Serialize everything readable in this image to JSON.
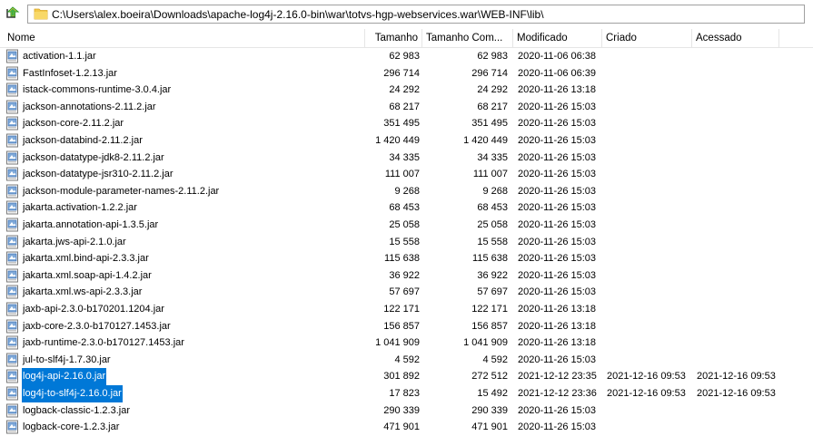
{
  "address": {
    "path": "C:\\Users\\alex.boeira\\Downloads\\apache-log4j-2.16.0-bin\\war\\totvs-hgp-webservices.war\\WEB-INF\\lib\\"
  },
  "columns": {
    "name": "Nome",
    "size": "Tamanho",
    "compressed": "Tamanho Com...",
    "modified": "Modificado",
    "created": "Criado",
    "accessed": "Acessado"
  },
  "files": [
    {
      "name": "activation-1.1.jar",
      "size": "62 983",
      "compressed": "62 983",
      "modified": "2020-11-06 06:38",
      "created": "",
      "accessed": "",
      "selected": false
    },
    {
      "name": "FastInfoset-1.2.13.jar",
      "size": "296 714",
      "compressed": "296 714",
      "modified": "2020-11-06 06:39",
      "created": "",
      "accessed": "",
      "selected": false
    },
    {
      "name": "istack-commons-runtime-3.0.4.jar",
      "size": "24 292",
      "compressed": "24 292",
      "modified": "2020-11-26 13:18",
      "created": "",
      "accessed": "",
      "selected": false
    },
    {
      "name": "jackson-annotations-2.11.2.jar",
      "size": "68 217",
      "compressed": "68 217",
      "modified": "2020-11-26 15:03",
      "created": "",
      "accessed": "",
      "selected": false
    },
    {
      "name": "jackson-core-2.11.2.jar",
      "size": "351 495",
      "compressed": "351 495",
      "modified": "2020-11-26 15:03",
      "created": "",
      "accessed": "",
      "selected": false
    },
    {
      "name": "jackson-databind-2.11.2.jar",
      "size": "1 420 449",
      "compressed": "1 420 449",
      "modified": "2020-11-26 15:03",
      "created": "",
      "accessed": "",
      "selected": false
    },
    {
      "name": "jackson-datatype-jdk8-2.11.2.jar",
      "size": "34 335",
      "compressed": "34 335",
      "modified": "2020-11-26 15:03",
      "created": "",
      "accessed": "",
      "selected": false
    },
    {
      "name": "jackson-datatype-jsr310-2.11.2.jar",
      "size": "111 007",
      "compressed": "111 007",
      "modified": "2020-11-26 15:03",
      "created": "",
      "accessed": "",
      "selected": false
    },
    {
      "name": "jackson-module-parameter-names-2.11.2.jar",
      "size": "9 268",
      "compressed": "9 268",
      "modified": "2020-11-26 15:03",
      "created": "",
      "accessed": "",
      "selected": false
    },
    {
      "name": "jakarta.activation-1.2.2.jar",
      "size": "68 453",
      "compressed": "68 453",
      "modified": "2020-11-26 15:03",
      "created": "",
      "accessed": "",
      "selected": false
    },
    {
      "name": "jakarta.annotation-api-1.3.5.jar",
      "size": "25 058",
      "compressed": "25 058",
      "modified": "2020-11-26 15:03",
      "created": "",
      "accessed": "",
      "selected": false
    },
    {
      "name": "jakarta.jws-api-2.1.0.jar",
      "size": "15 558",
      "compressed": "15 558",
      "modified": "2020-11-26 15:03",
      "created": "",
      "accessed": "",
      "selected": false
    },
    {
      "name": "jakarta.xml.bind-api-2.3.3.jar",
      "size": "115 638",
      "compressed": "115 638",
      "modified": "2020-11-26 15:03",
      "created": "",
      "accessed": "",
      "selected": false
    },
    {
      "name": "jakarta.xml.soap-api-1.4.2.jar",
      "size": "36 922",
      "compressed": "36 922",
      "modified": "2020-11-26 15:03",
      "created": "",
      "accessed": "",
      "selected": false
    },
    {
      "name": "jakarta.xml.ws-api-2.3.3.jar",
      "size": "57 697",
      "compressed": "57 697",
      "modified": "2020-11-26 15:03",
      "created": "",
      "accessed": "",
      "selected": false
    },
    {
      "name": "jaxb-api-2.3.0-b170201.1204.jar",
      "size": "122 171",
      "compressed": "122 171",
      "modified": "2020-11-26 13:18",
      "created": "",
      "accessed": "",
      "selected": false
    },
    {
      "name": "jaxb-core-2.3.0-b170127.1453.jar",
      "size": "156 857",
      "compressed": "156 857",
      "modified": "2020-11-26 13:18",
      "created": "",
      "accessed": "",
      "selected": false
    },
    {
      "name": "jaxb-runtime-2.3.0-b170127.1453.jar",
      "size": "1 041 909",
      "compressed": "1 041 909",
      "modified": "2020-11-26 13:18",
      "created": "",
      "accessed": "",
      "selected": false
    },
    {
      "name": "jul-to-slf4j-1.7.30.jar",
      "size": "4 592",
      "compressed": "4 592",
      "modified": "2020-11-26 15:03",
      "created": "",
      "accessed": "",
      "selected": false
    },
    {
      "name": "log4j-api-2.16.0.jar",
      "size": "301 892",
      "compressed": "272 512",
      "modified": "2021-12-12 23:35",
      "created": "2021-12-16 09:53",
      "accessed": "2021-12-16 09:53",
      "selected": true
    },
    {
      "name": "log4j-to-slf4j-2.16.0.jar",
      "size": "17 823",
      "compressed": "15 492",
      "modified": "2021-12-12 23:36",
      "created": "2021-12-16 09:53",
      "accessed": "2021-12-16 09:53",
      "selected": true
    },
    {
      "name": "logback-classic-1.2.3.jar",
      "size": "290 339",
      "compressed": "290 339",
      "modified": "2020-11-26 15:03",
      "created": "",
      "accessed": "",
      "selected": false
    },
    {
      "name": "logback-core-1.2.3.jar",
      "size": "471 901",
      "compressed": "471 901",
      "modified": "2020-11-26 15:03",
      "created": "",
      "accessed": "",
      "selected": false
    }
  ],
  "colors": {
    "selection": "#0078d7",
    "folder": "#f3c94b",
    "up_arrow": "#2e9d2e"
  },
  "icons": {
    "up": "up-folder-icon",
    "folder": "folder-icon",
    "file": "jar-file-icon"
  }
}
